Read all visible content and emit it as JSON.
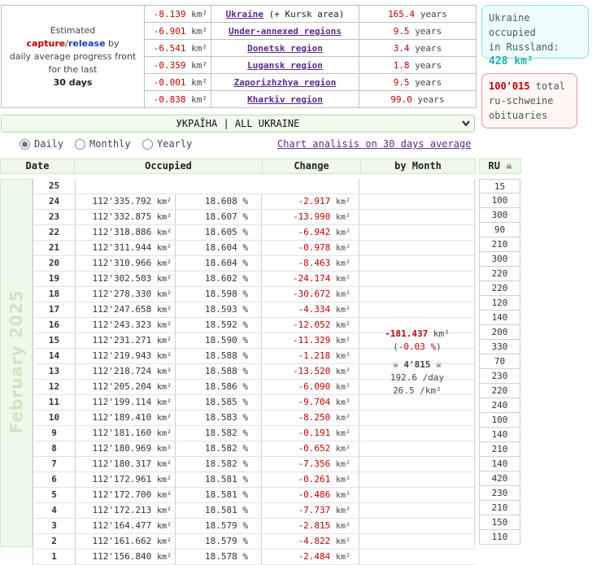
{
  "summary": {
    "estimated_text_1": "Estimated",
    "capture_word": "capture",
    "slash": "/",
    "release_word": "release",
    "by_word": " by",
    "estimated_text_2": "daily average progress front for the last",
    "period": "30 days",
    "regions": [
      {
        "change": "-8.139",
        "unit": "km²",
        "name": "Ukraine",
        "suffix": " (+ Kursk area)",
        "years": "165.4",
        "years_word": "years"
      },
      {
        "change": "-6.901",
        "unit": "km²",
        "name": "Under-annexed regions",
        "suffix": "",
        "years": "9.5",
        "years_word": "years"
      },
      {
        "change": "-6.541",
        "unit": "km²",
        "name": "Donetsk region",
        "suffix": "",
        "years": "3.4",
        "years_word": "years"
      },
      {
        "change": "-0.359",
        "unit": "km²",
        "name": "Lugansk region",
        "suffix": "",
        "years": "1.8",
        "years_word": "years"
      },
      {
        "change": "-0.001",
        "unit": "km²",
        "name": "Zaporizhzhya region",
        "suffix": "",
        "years": "9.5",
        "years_word": "years"
      },
      {
        "change": "-0.838",
        "unit": "km²",
        "name": "Kharkiv region",
        "suffix": "",
        "years": "99.0",
        "years_word": "years"
      }
    ]
  },
  "occupied_box": {
    "line1": "Ukraine occupied",
    "line2": "in Russland:",
    "value": "428 km²"
  },
  "obituaries_box": {
    "value": "100'015",
    "text1": " total",
    "text2": "ru-schweine",
    "text3": "obituaries"
  },
  "region_select": {
    "value": "УКРАЇНА | ALL UKRAINE"
  },
  "view_options": [
    {
      "label": "Daily",
      "selected": true
    },
    {
      "label": "Monthly",
      "selected": false
    },
    {
      "label": "Yearly",
      "selected": false
    }
  ],
  "chart_link": "Chart analisis on 30 days average",
  "table_headers": {
    "date": "Date",
    "occupied": "Occupied",
    "change": "Change",
    "by_month": "by Month",
    "ru": "RU ☠"
  },
  "month_label": "February 2025",
  "month_summary": {
    "change": "-181.437",
    "unit": "km²",
    "pct_open": "(",
    "pct": "-0.03 %",
    "pct_close": ")",
    "obits": "☠ 4'815 ☠",
    "per_day": "192.6 /day",
    "per_km": "26.5 /km²"
  },
  "rows": [
    {
      "day": "25",
      "occupied": "",
      "unit": "",
      "pct": "",
      "change": "",
      "cunit": ""
    },
    {
      "day": "24",
      "occupied": "112'335.792",
      "unit": "km²",
      "pct": "18.608 %",
      "change": "-2.917",
      "cunit": "km²"
    },
    {
      "day": "23",
      "occupied": "112'332.875",
      "unit": "km²",
      "pct": "18.607 %",
      "change": "-13.990",
      "cunit": "km²"
    },
    {
      "day": "22",
      "occupied": "112'318.886",
      "unit": "km²",
      "pct": "18.605 %",
      "change": "-6.942",
      "cunit": "km²"
    },
    {
      "day": "21",
      "occupied": "112'311.944",
      "unit": "km²",
      "pct": "18.604 %",
      "change": "-0.978",
      "cunit": "km²"
    },
    {
      "day": "20",
      "occupied": "112'310.966",
      "unit": "km²",
      "pct": "18.604 %",
      "change": "-8.463",
      "cunit": "km²"
    },
    {
      "day": "19",
      "occupied": "112'302.503",
      "unit": "km²",
      "pct": "18.602 %",
      "change": "-24.174",
      "cunit": "km²"
    },
    {
      "day": "18",
      "occupied": "112'278.330",
      "unit": "km²",
      "pct": "18.598 %",
      "change": "-30.672",
      "cunit": "km²"
    },
    {
      "day": "17",
      "occupied": "112'247.658",
      "unit": "km²",
      "pct": "18.593 %",
      "change": "-4.334",
      "cunit": "km²"
    },
    {
      "day": "16",
      "occupied": "112'243.323",
      "unit": "km²",
      "pct": "18.592 %",
      "change": "-12.052",
      "cunit": "km²"
    },
    {
      "day": "15",
      "occupied": "112'231.271",
      "unit": "km²",
      "pct": "18.590 %",
      "change": "-11.329",
      "cunit": "km²"
    },
    {
      "day": "14",
      "occupied": "112'219.943",
      "unit": "km²",
      "pct": "18.588 %",
      "change": "-1.218",
      "cunit": "km²"
    },
    {
      "day": "13",
      "occupied": "112'218.724",
      "unit": "km²",
      "pct": "18.588 %",
      "change": "-13.520",
      "cunit": "km²"
    },
    {
      "day": "12",
      "occupied": "112'205.204",
      "unit": "km²",
      "pct": "18.586 %",
      "change": "-6.090",
      "cunit": "km²"
    },
    {
      "day": "11",
      "occupied": "112'199.114",
      "unit": "km²",
      "pct": "18.585 %",
      "change": "-9.704",
      "cunit": "km²"
    },
    {
      "day": "10",
      "occupied": "112'189.410",
      "unit": "km²",
      "pct": "18.583 %",
      "change": "-8.250",
      "cunit": "km²"
    },
    {
      "day": "9",
      "occupied": "112'181.160",
      "unit": "km²",
      "pct": "18.582 %",
      "change": "-0.191",
      "cunit": "km²"
    },
    {
      "day": "8",
      "occupied": "112'180.969",
      "unit": "km²",
      "pct": "18.582 %",
      "change": "-0.652",
      "cunit": "km²"
    },
    {
      "day": "7",
      "occupied": "112'180.317",
      "unit": "km²",
      "pct": "18.582 %",
      "change": "-7.356",
      "cunit": "km²"
    },
    {
      "day": "6",
      "occupied": "112'172.961",
      "unit": "km²",
      "pct": "18.581 %",
      "change": "-0.261",
      "cunit": "km²"
    },
    {
      "day": "5",
      "occupied": "112'172.700",
      "unit": "km²",
      "pct": "18.581 %",
      "change": "-0.486",
      "cunit": "km²"
    },
    {
      "day": "4",
      "occupied": "112'172.213",
      "unit": "km²",
      "pct": "18.581 %",
      "change": "-7.737",
      "cunit": "km²"
    },
    {
      "day": "3",
      "occupied": "112'164.477",
      "unit": "km²",
      "pct": "18.579 %",
      "change": "-2.815",
      "cunit": "km²"
    },
    {
      "day": "2",
      "occupied": "112'161.662",
      "unit": "km²",
      "pct": "18.579 %",
      "change": "-4.822",
      "cunit": "km²"
    },
    {
      "day": "1",
      "occupied": "112'156.840",
      "unit": "km²",
      "pct": "18.578 %",
      "change": "-2.484",
      "cunit": "km²"
    }
  ],
  "ru_values": [
    "15",
    "100",
    "300",
    "90",
    "210",
    "300",
    "220",
    "220",
    "120",
    "140",
    "200",
    "330",
    "70",
    "230",
    "220",
    "240",
    "100",
    "140",
    "210",
    "140",
    "420",
    "230",
    "210",
    "150",
    "110"
  ]
}
